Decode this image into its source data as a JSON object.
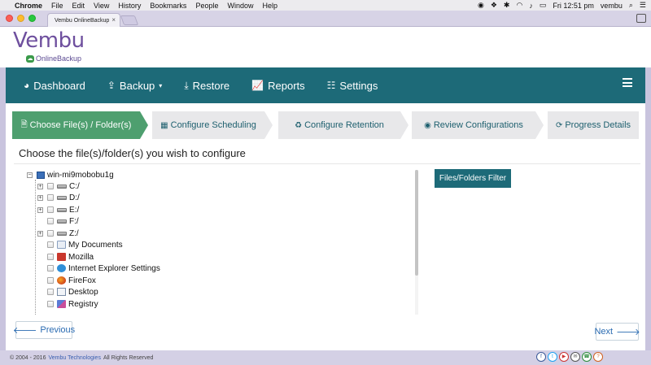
{
  "mac_menubar": {
    "app_name": "Chrome",
    "items": [
      "File",
      "Edit",
      "View",
      "History",
      "Bookmarks",
      "People",
      "Window",
      "Help"
    ],
    "clock": "Fri 12:51 pm",
    "user": "vembu"
  },
  "browser": {
    "tab_title": "Vembu OnlineBackup"
  },
  "logo": {
    "name": "Vembu",
    "product": "OnlineBackup"
  },
  "nav": {
    "items": [
      {
        "label": "Dashboard",
        "icon": "pie-chart-icon"
      },
      {
        "label": "Backup",
        "icon": "upload-icon"
      },
      {
        "label": "Restore",
        "icon": "download-icon"
      },
      {
        "label": "Reports",
        "icon": "line-chart-icon"
      },
      {
        "label": "Settings",
        "icon": "sliders-icon"
      }
    ],
    "menu_icon": "hamburger-icon"
  },
  "wizard": {
    "steps": [
      {
        "label": "Choose File(s) / Folder(s)",
        "icon": "file-icon",
        "active": true
      },
      {
        "label": "Configure Scheduling",
        "icon": "calendar-icon",
        "active": false
      },
      {
        "label": "Configure Retention",
        "icon": "recycle-icon",
        "active": false
      },
      {
        "label": "Review Configurations",
        "icon": "eye-icon",
        "active": false
      },
      {
        "label": "Progress Details",
        "icon": "refresh-icon",
        "active": false
      }
    ],
    "active_color": "#4e9f6f"
  },
  "page": {
    "heading": "Choose the file(s)/folder(s) you wish to configure",
    "filter_button": "Files/Folders Filter",
    "previous_button": "Previous",
    "next_button": "Next"
  },
  "tree": {
    "root": "win-mi9mobobu1g",
    "items": [
      {
        "label": "C:/",
        "icon": "drive-icon",
        "expandable": true
      },
      {
        "label": "D:/",
        "icon": "drive-icon",
        "expandable": true
      },
      {
        "label": "E:/",
        "icon": "drive-icon",
        "expandable": true
      },
      {
        "label": "F:/",
        "icon": "drive-icon",
        "expandable": false
      },
      {
        "label": "Z:/",
        "icon": "drive-icon",
        "expandable": true
      },
      {
        "label": "My Documents",
        "icon": "documents-icon",
        "expandable": false
      },
      {
        "label": "Mozilla",
        "icon": "mozilla-icon",
        "expandable": false
      },
      {
        "label": "Internet Explorer Settings",
        "icon": "ie-icon",
        "expandable": false
      },
      {
        "label": "FireFox",
        "icon": "firefox-icon",
        "expandable": false
      },
      {
        "label": "Desktop",
        "icon": "desktop-icon",
        "expandable": false
      },
      {
        "label": "Registry",
        "icon": "registry-icon",
        "expandable": false
      }
    ]
  },
  "footer": {
    "copyright_prefix": "© 2004 - 2016",
    "company": "Vembu Technologies",
    "rights": "All Rights Reserved",
    "social": [
      "facebook-icon",
      "twitter-icon",
      "youtube-icon",
      "email-icon",
      "phone-icon",
      "help-icon"
    ]
  },
  "colors": {
    "nav_bg": "#1d6a78",
    "step_active": "#4e9f6f",
    "brand_purple": "#6e4f9e",
    "link_blue": "#2a6bb2"
  }
}
